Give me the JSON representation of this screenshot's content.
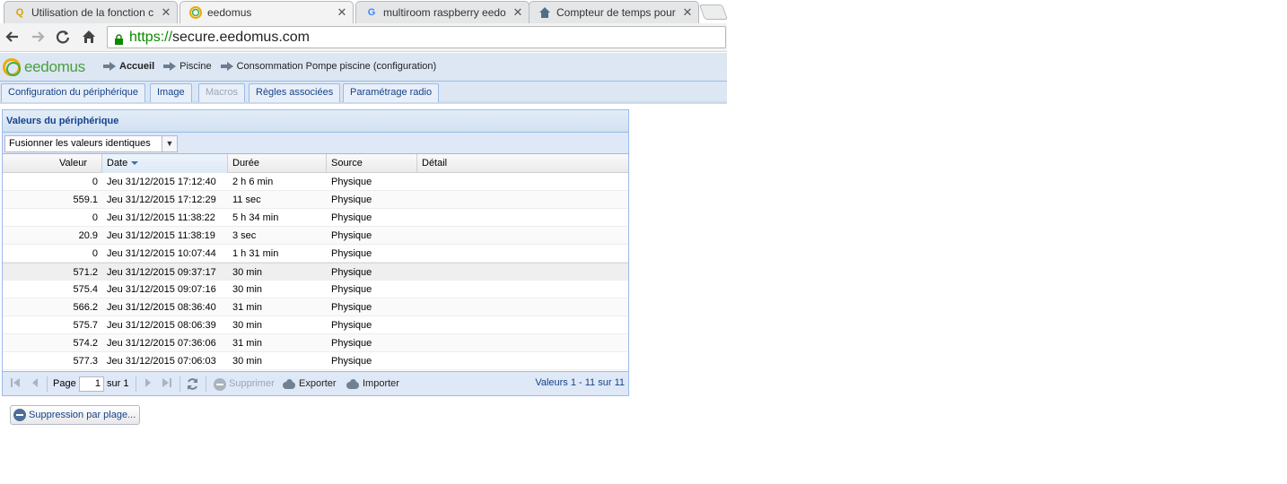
{
  "browser": {
    "tabs": [
      {
        "title": "Utilisation de la fonction c",
        "favicon": "Q"
      },
      {
        "title": "eedomus",
        "favicon": "eedomus-ring",
        "active": true
      },
      {
        "title": "multiroom raspberry eedo",
        "favicon": "G"
      },
      {
        "title": "Compteur de temps pour",
        "favicon": "house"
      }
    ],
    "close_glyph": "✕",
    "url_scheme": "https://",
    "url_host": "secure.eedomus.com"
  },
  "app": {
    "logo_text": "eedomus",
    "breadcrumb": [
      "Accueil",
      "Piscine",
      "Consommation Pompe piscine (configuration)"
    ],
    "tabs": [
      {
        "label": "Configuration du périphérique",
        "disabled": false
      },
      {
        "label": "Image",
        "disabled": false
      },
      {
        "label": "Macros",
        "disabled": true
      },
      {
        "label": "Règles associées",
        "disabled": false
      },
      {
        "label": "Paramétrage radio",
        "disabled": false
      }
    ]
  },
  "panel": {
    "title": "Valeurs du périphérique",
    "combo_value": "Fusionner les valeurs identiques"
  },
  "grid": {
    "columns": [
      "Valeur",
      "Date",
      "Durée",
      "Source",
      "Détail"
    ],
    "sorted_column": "Date",
    "rows": [
      {
        "valeur": "0",
        "date": "Jeu 31/12/2015 17:12:40",
        "duree": "2 h 6 min",
        "source": "Physique",
        "detail": ""
      },
      {
        "valeur": "559.1",
        "date": "Jeu 31/12/2015 17:12:29",
        "duree": "11 sec",
        "source": "Physique",
        "detail": ""
      },
      {
        "valeur": "0",
        "date": "Jeu 31/12/2015 11:38:22",
        "duree": "5 h 34 min",
        "source": "Physique",
        "detail": ""
      },
      {
        "valeur": "20.9",
        "date": "Jeu 31/12/2015 11:38:19",
        "duree": "3 sec",
        "source": "Physique",
        "detail": ""
      },
      {
        "valeur": "0",
        "date": "Jeu 31/12/2015 10:07:44",
        "duree": "1 h 31 min",
        "source": "Physique",
        "detail": ""
      },
      {
        "valeur": "571.2",
        "date": "Jeu 31/12/2015 09:37:17",
        "duree": "30 min",
        "source": "Physique",
        "detail": ""
      },
      {
        "valeur": "575.4",
        "date": "Jeu 31/12/2015 09:07:16",
        "duree": "30 min",
        "source": "Physique",
        "detail": ""
      },
      {
        "valeur": "566.2",
        "date": "Jeu 31/12/2015 08:36:40",
        "duree": "31 min",
        "source": "Physique",
        "detail": ""
      },
      {
        "valeur": "575.7",
        "date": "Jeu 31/12/2015 08:06:39",
        "duree": "30 min",
        "source": "Physique",
        "detail": ""
      },
      {
        "valeur": "574.2",
        "date": "Jeu 31/12/2015 07:36:06",
        "duree": "31 min",
        "source": "Physique",
        "detail": ""
      },
      {
        "valeur": "577.3",
        "date": "Jeu 31/12/2015 07:06:03",
        "duree": "30 min",
        "source": "Physique",
        "detail": ""
      }
    ]
  },
  "pager": {
    "page_label": "Page",
    "page_value": "1",
    "of_label": "sur 1",
    "delete_label": "Supprimer",
    "export_label": "Exporter",
    "import_label": "Importer",
    "status": "Valeurs 1 - 11 sur 11"
  },
  "range_delete_label": "Suppression par plage..."
}
